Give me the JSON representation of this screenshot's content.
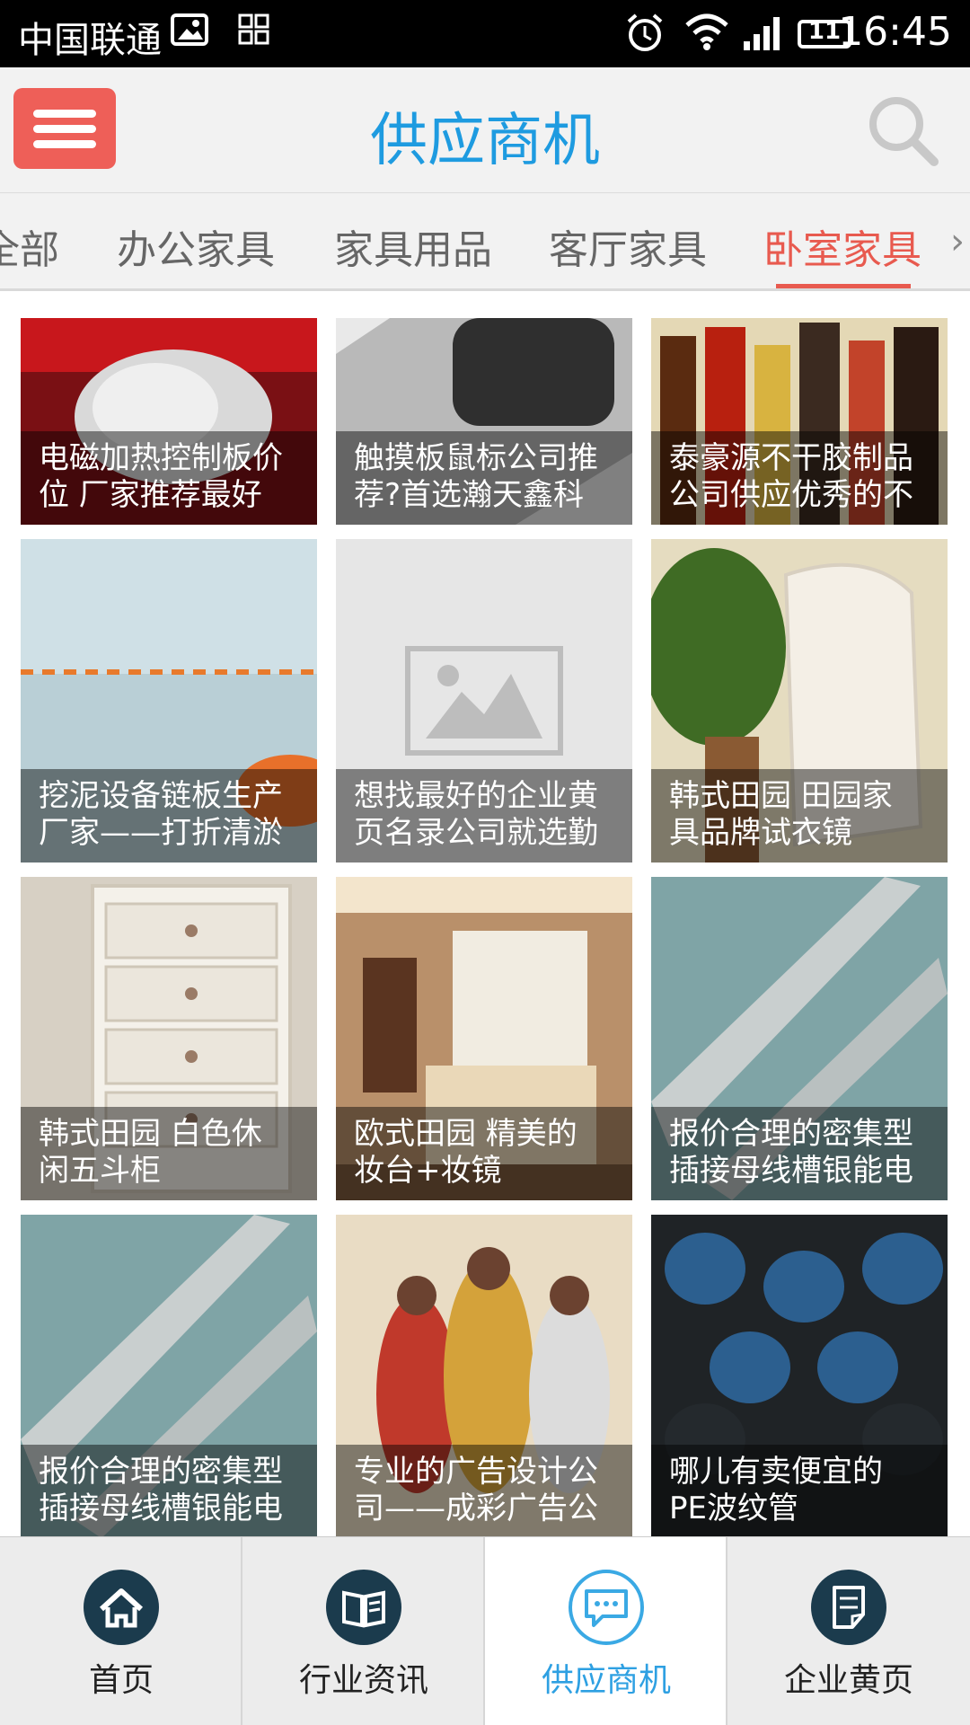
{
  "status_bar": {
    "carrier": "中国联通",
    "time": "16:45",
    "battery": "11"
  },
  "header": {
    "title": "供应商机"
  },
  "category_tabs": [
    {
      "label": "全部"
    },
    {
      "label": "办公家具"
    },
    {
      "label": "家具用品"
    },
    {
      "label": "客厅家具"
    },
    {
      "label": "卧室家具",
      "active": true
    }
  ],
  "products": [
    {
      "line1": "电磁加热控制板价",
      "line2": "位 厂家推荐最好"
    },
    {
      "line1": "触摸板鼠标公司推",
      "line2": "荐?首选瀚天鑫科"
    },
    {
      "line1": "泰豪源不干胶制品",
      "line2": "公司供应优秀的不"
    },
    {
      "line1": "挖泥设备链板生产",
      "line2": "厂家——打折清淤"
    },
    {
      "line1": "想找最好的企业黄",
      "line2": "页名录公司就选勤"
    },
    {
      "line1": "韩式田园 田园家",
      "line2": "具品牌试衣镜"
    },
    {
      "line1": "韩式田园 白色休",
      "line2": "闲五斗柜"
    },
    {
      "line1": "欧式田园 精美的",
      "line2": "妆台+妆镜"
    },
    {
      "line1": "报价合理的密集型",
      "line2": "插接母线槽银能电"
    },
    {
      "line1": "报价合理的密集型",
      "line2": "插接母线槽银能电"
    },
    {
      "line1": "专业的广告设计公",
      "line2": "司——成彩广告公"
    },
    {
      "line1": "哪儿有卖便宜的",
      "line2": "PE波纹管"
    }
  ],
  "bottom_nav": [
    {
      "label": "首页",
      "icon": "home-icon"
    },
    {
      "label": "行业资讯",
      "icon": "book-icon"
    },
    {
      "label": "供应商机",
      "icon": "chat-icon",
      "active": true
    },
    {
      "label": "企业黄页",
      "icon": "document-icon"
    }
  ],
  "colors": {
    "accent": "#1e9be0",
    "active_tab": "#e85a4f",
    "menu_button": "#ee5f58",
    "nav_circle": "#1b3b4d"
  }
}
